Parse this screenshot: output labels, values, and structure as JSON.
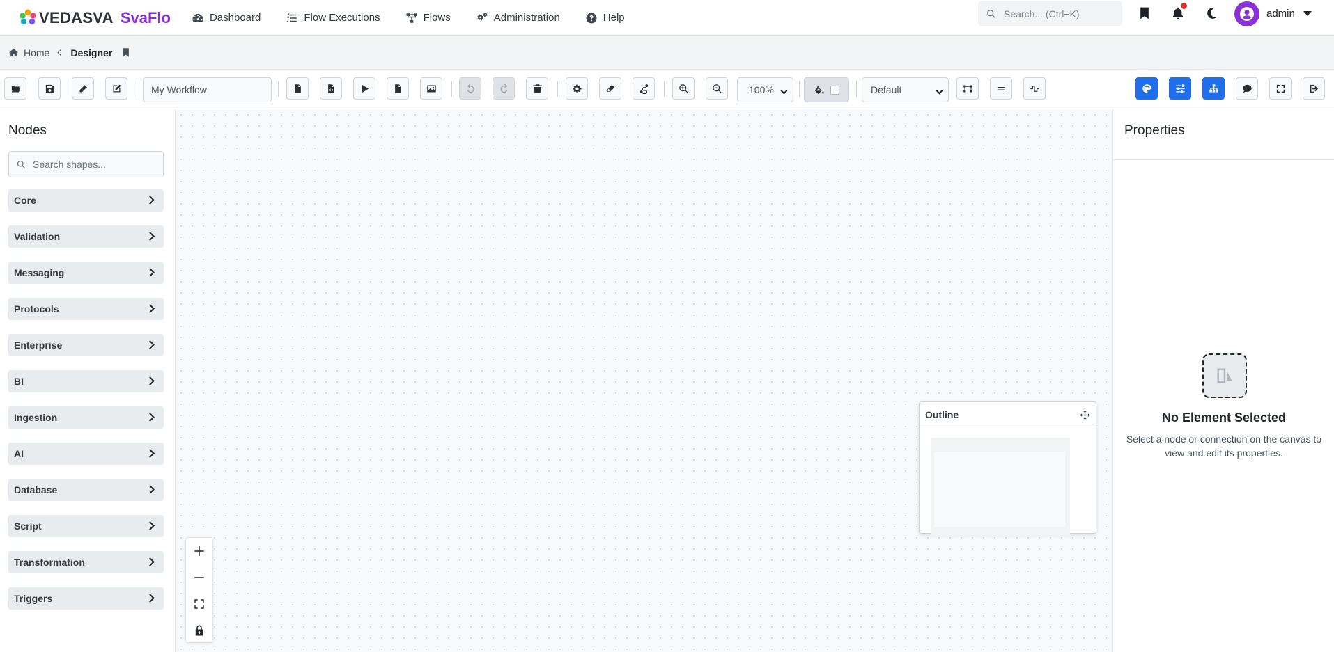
{
  "brand": {
    "name": "VEDASVA",
    "product": "SvaFlo"
  },
  "nav": [
    {
      "label": "Dashboard",
      "icon": "dashboard-icon"
    },
    {
      "label": "Flow Executions",
      "icon": "list-check-icon"
    },
    {
      "label": "Flows",
      "icon": "flow-icon"
    },
    {
      "label": "Administration",
      "icon": "gears-icon"
    },
    {
      "label": "Help",
      "icon": "help-icon"
    }
  ],
  "search": {
    "placeholder": "Search... (Ctrl+K)"
  },
  "user": {
    "name": "admin"
  },
  "breadcrumb": {
    "home": "Home",
    "current": "Designer"
  },
  "toolbar": {
    "workflow_name": "My Workflow",
    "zoom": "100%",
    "layout": "Default"
  },
  "sidebar": {
    "title": "Nodes",
    "search_placeholder": "Search shapes...",
    "categories": [
      "Core",
      "Validation",
      "Messaging",
      "Protocols",
      "Enterprise",
      "BI",
      "Ingestion",
      "AI",
      "Database",
      "Script",
      "Transformation",
      "Triggers"
    ]
  },
  "outline": {
    "title": "Outline"
  },
  "properties": {
    "title": "Properties",
    "empty_title": "No Element Selected",
    "empty_desc": "Select a node or connection on the canvas to view and edit its properties."
  },
  "colors": {
    "brand_purple": "#8a2fd6",
    "primary_blue": "#1f6feb",
    "notification_red": "#e03131"
  }
}
